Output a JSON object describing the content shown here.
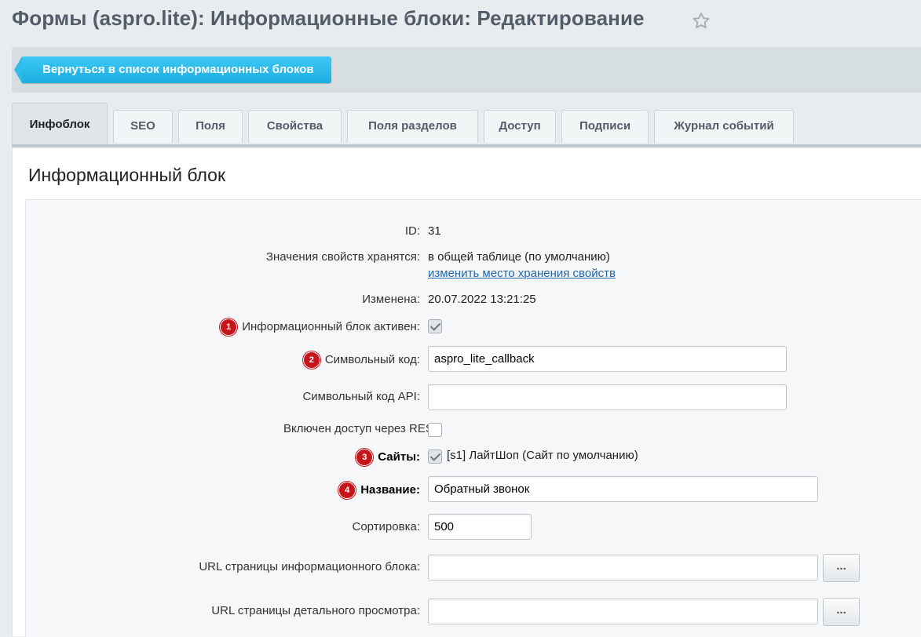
{
  "header": {
    "title": "Формы (aspro.lite): Информационные блоки: Редактирование",
    "star_icon": "star-icon"
  },
  "toolbar": {
    "back_label": "Вернуться в список информационных блоков"
  },
  "tabs": [
    {
      "label": "Инфоблок",
      "active": true
    },
    {
      "label": "SEO"
    },
    {
      "label": "Поля"
    },
    {
      "label": "Свойства"
    },
    {
      "label": "Поля разделов"
    },
    {
      "label": "Доступ"
    },
    {
      "label": "Подписи"
    },
    {
      "label": "Журнал событий"
    }
  ],
  "section": {
    "title": "Информационный блок"
  },
  "form": {
    "id_label": "ID:",
    "id_value": "31",
    "storage_label": "Значения свойств хранятся:",
    "storage_value": "в общей таблице (по умолчанию)",
    "storage_link": "изменить место хранения свойств",
    "modified_label": "Изменена:",
    "modified_value": "20.07.2022 13:21:25",
    "active_badge": "1",
    "active_label": "Информационный блок активен:",
    "active_checked": true,
    "code_badge": "2",
    "code_label": "Символьный код:",
    "code_value": "aspro_lite_callback",
    "api_code_label": "Символьный код API:",
    "api_code_value": "",
    "rest_label": "Включен доступ через REST",
    "rest_checked": false,
    "sites_badge": "3",
    "sites_label": "Сайты:",
    "sites_value": "[s1] ЛайтШоп (Сайт по умолчанию)",
    "sites_checked": true,
    "name_badge": "4",
    "name_label": "Название:",
    "name_value": "Обратный звонок",
    "sort_label": "Сортировка:",
    "sort_value": "500",
    "list_url_label": "URL страницы информационного блока:",
    "list_url_value": "",
    "detail_url_label": "URL страницы детального просмотра:",
    "detail_url_value": "",
    "browse_button": "..."
  },
  "colors": {
    "accent": "#2fc6f6",
    "badge": "#c6161c",
    "link": "#2067b0",
    "title": "#535c69"
  }
}
